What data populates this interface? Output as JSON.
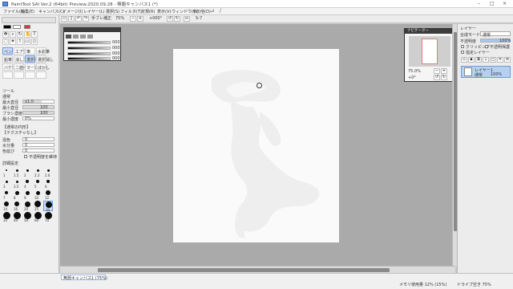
{
  "window": {
    "title": "PaintTool SAI Ver.2 (64bit) Preview.2020.09.28 - 無題キャンバス1 (*)"
  },
  "menubar": {
    "items": [
      "ファイル(F)",
      "編集(E)",
      "キャンバス(C)",
      "イメージ(I)",
      "レイヤー(L)",
      "選択(S)",
      "フィルタ(T)",
      "定規(R)",
      "表示(V)",
      "ウィンドウ(W)",
      "その他(O)"
    ]
  },
  "toolbar": {
    "antialias_label": "手ブレ補正",
    "stabilizer_value": "S-7",
    "zoom_value": "75%",
    "rotation_value": "+000°"
  },
  "left_panel": {
    "tool_header": "ツール",
    "tool_labels": [
      "ペン",
      "エアブラシ",
      "筆",
      "水彩筆",
      "鉛筆",
      "消しゴム",
      "選択ペン",
      "選択消し",
      "バケツ",
      "二値ペン",
      "マーカー",
      "ぼかし"
    ],
    "props": [
      {
        "label": "通常",
        "value": ""
      },
      {
        "label": "最大直径",
        "value": "x1.0"
      },
      {
        "label": "最小直径",
        "value": "100"
      },
      {
        "label": "ブラシ濃度",
        "value": "100"
      },
      {
        "label": "最小濃度",
        "value": "0%"
      }
    ],
    "section_blend": "【通常の円形】",
    "section_texture": "【テクスチャなし】",
    "blend_props": [
      {
        "label": "混色",
        "value": "0"
      },
      {
        "label": "水分量",
        "value": "0"
      },
      {
        "label": "色延び",
        "value": "0"
      }
    ],
    "checkbox_label": "不透明度を維持",
    "presets_header": "詳細設定",
    "size_values": [
      "1",
      "1.5",
      "2",
      "2.3",
      "2.6",
      "3",
      "3.5",
      "4",
      "5",
      "6",
      "7",
      "8",
      "9",
      "10",
      "12",
      "14",
      "16",
      "20",
      "25",
      "30",
      "35",
      "40",
      "50",
      "60",
      "70"
    ]
  },
  "palette_window": {
    "values": [
      "000",
      "000",
      "000",
      "000"
    ]
  },
  "navigator": {
    "title": "ナビゲーター",
    "zoom_value": "75.0%",
    "rotate_value": "+0°"
  },
  "right_panel": {
    "layer_header": "レイヤー",
    "mode_label": "合成モード",
    "mode_value": "通常",
    "opacity_label": "不透明度",
    "opacity_value": "100%",
    "checkbox_clip": "クリッピング",
    "checkbox_protect": "不透明保護",
    "checkbox_selsrc": "指定レイヤー",
    "layer_name": "レイヤー1",
    "layer_mode": "通常",
    "layer_opacity": "100%"
  },
  "statusbar": {
    "doc_tab": "無題キャンバス1 (75%)",
    "memory": "メモリ使用量 12% (15%)",
    "drive": "ドライブ空き 75%"
  }
}
